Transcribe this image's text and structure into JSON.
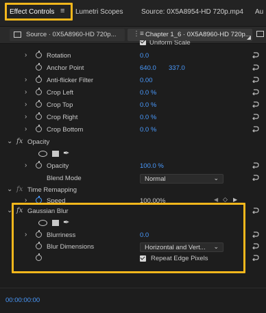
{
  "tabs": {
    "effect_controls": "Effect Controls",
    "menu_glyph": "≡",
    "lumetri": "Lumetri Scopes",
    "source": "Source: 0X5A8954-HD 720p.mp4",
    "audio": "Au"
  },
  "source_bar": {
    "source_label": "Source · 0X5A8960-HD 720p...",
    "sequence_label": "Chapter 1_6 · 0X5A8960-HD 720p..."
  },
  "rows": {
    "uniform_scale": "Uniform Scale",
    "rotation": {
      "label": "Rotation",
      "value": "0.0"
    },
    "anchor_point": {
      "label": "Anchor Point",
      "x": "640.0",
      "y": "337.0"
    },
    "anti_flicker": {
      "label": "Anti-flicker Filter",
      "value": "0.00"
    },
    "crop_left": {
      "label": "Crop Left",
      "value": "0.0 %"
    },
    "crop_top": {
      "label": "Crop Top",
      "value": "0.0 %"
    },
    "crop_right": {
      "label": "Crop Right",
      "value": "0.0 %"
    },
    "crop_bottom": {
      "label": "Crop Bottom",
      "value": "0.0 %"
    },
    "opacity_section": "Opacity",
    "opacity": {
      "label": "Opacity",
      "value": "100.0 %"
    },
    "blend_mode": {
      "label": "Blend Mode",
      "value": "Normal"
    },
    "time_remapping": "Time Remapping",
    "speed": {
      "label": "Speed",
      "value": "100.00%"
    },
    "gaussian_blur": "Gaussian Blur",
    "blurriness": {
      "label": "Blurriness",
      "value": "0.0"
    },
    "blur_dimensions": {
      "label": "Blur Dimensions",
      "value": "Horizontal and Vert..."
    },
    "repeat_edge": "Repeat Edge Pixels"
  },
  "timecode": "00:00:00:00",
  "colors": {
    "highlight": "#f4b71c",
    "value_blue": "#4a9bff"
  },
  "icons": {
    "fx": "fx",
    "chevron_right": "›",
    "chevron_down": "⌄"
  }
}
